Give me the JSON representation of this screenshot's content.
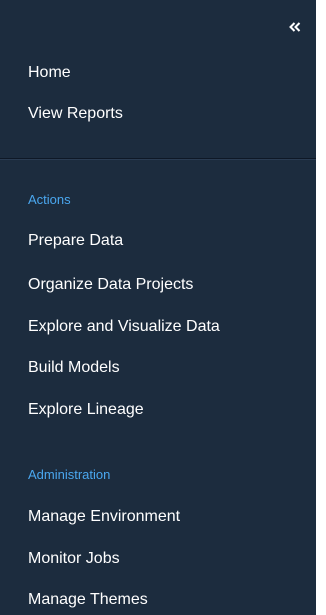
{
  "top_nav": {
    "items": [
      {
        "label": "Home"
      },
      {
        "label": "View Reports"
      }
    ]
  },
  "actions": {
    "header": "Actions",
    "items": [
      {
        "label": "Prepare Data"
      },
      {
        "label": "Organize Data Projects"
      },
      {
        "label": "Explore and Visualize Data"
      },
      {
        "label": "Build Models"
      },
      {
        "label": "Explore Lineage"
      }
    ]
  },
  "administration": {
    "header": "Administration",
    "items": [
      {
        "label": "Manage Environment"
      },
      {
        "label": "Monitor Jobs"
      },
      {
        "label": "Manage Themes"
      }
    ]
  },
  "icons": {
    "collapse": "double-chevron-left-icon"
  },
  "colors": {
    "panel_background": "#1c2c3e",
    "section_header": "#4aa7ef",
    "item_text": "#ffffff"
  }
}
